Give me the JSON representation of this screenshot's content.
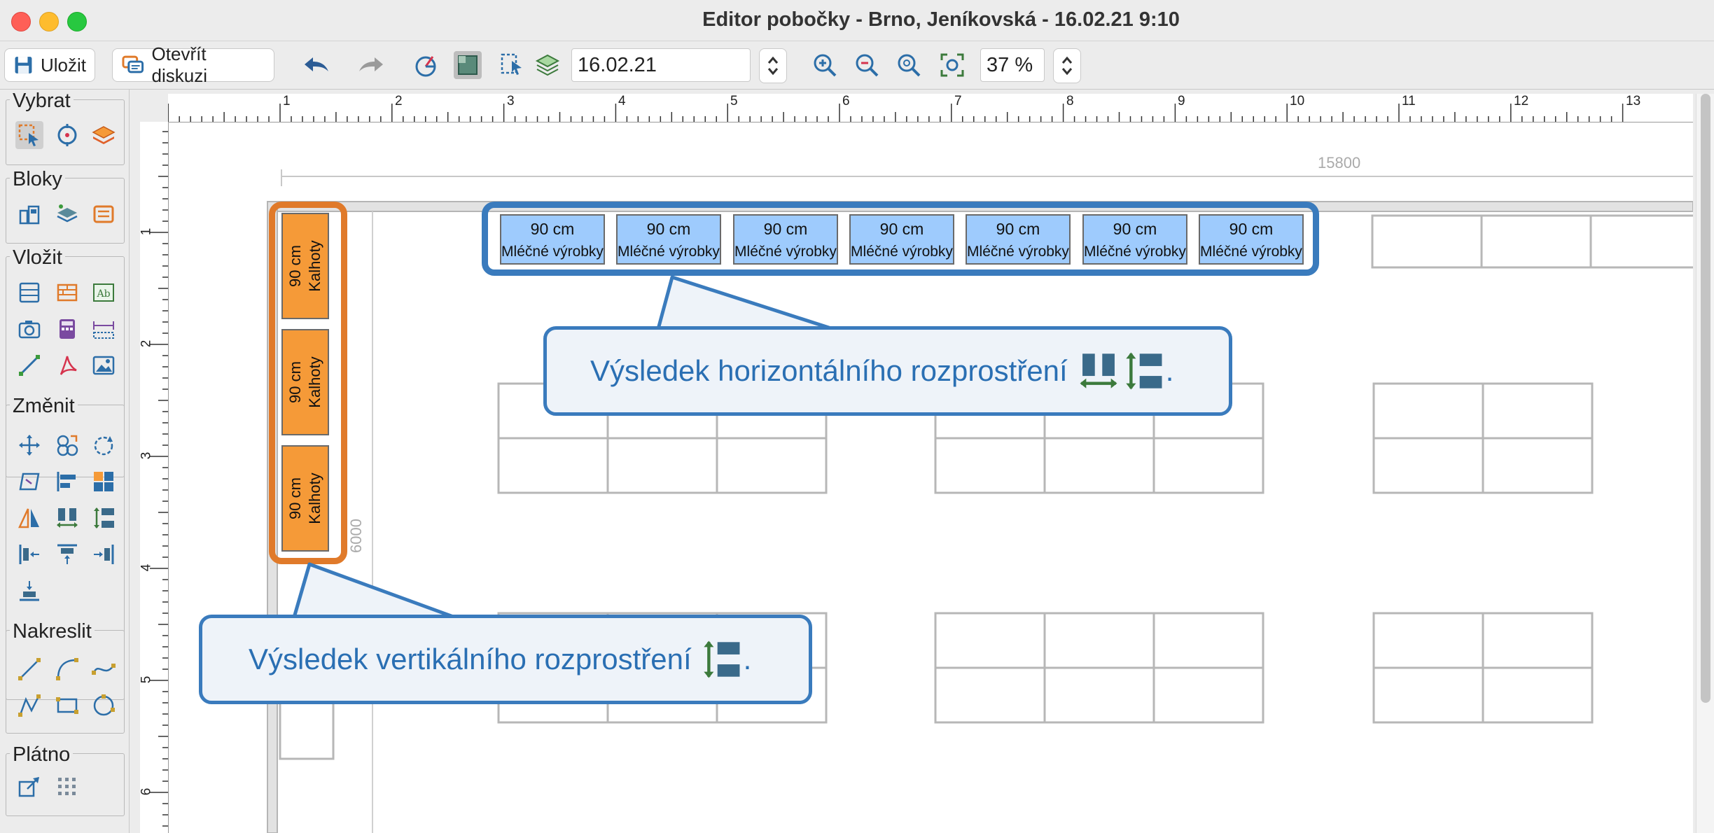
{
  "window": {
    "title": "Editor pobočky - Brno, Jeníkovská - 16.02.21 9:10"
  },
  "toolbar": {
    "save_label": "Uložit",
    "discussion_label": "Otevřít diskuzi",
    "date_value": "16.02.21",
    "zoom_value": "37 %"
  },
  "palette": {
    "groups": [
      "Vybrat",
      "Bloky",
      "Vložit",
      "Změnit",
      "Nakreslit",
      "Plátno"
    ]
  },
  "ruler": {
    "h_ticks": [
      "1",
      "2",
      "3",
      "4",
      "5",
      "6",
      "7",
      "8",
      "9",
      "10",
      "11",
      "12",
      "13"
    ],
    "v_ticks": [
      "1",
      "2",
      "3",
      "4",
      "5",
      "6"
    ]
  },
  "dimensions": {
    "width": "15800",
    "height": "6000"
  },
  "shelves_h": {
    "size": "90 cm",
    "label": "Mléčné výrobky"
  },
  "shelves_v": {
    "size": "90 cm",
    "label": "Kalhoty"
  },
  "callouts": {
    "horizontal": "Výsledek horizontálního rozprostření",
    "vertical": "Výsledek vertikálního rozprostření",
    "period": "."
  },
  "colors": {
    "accent_blue": "#3a7bbd",
    "accent_orange": "#e07a2a",
    "shelf_blue": "#9ecbfd",
    "shelf_orange": "#f59a38"
  }
}
